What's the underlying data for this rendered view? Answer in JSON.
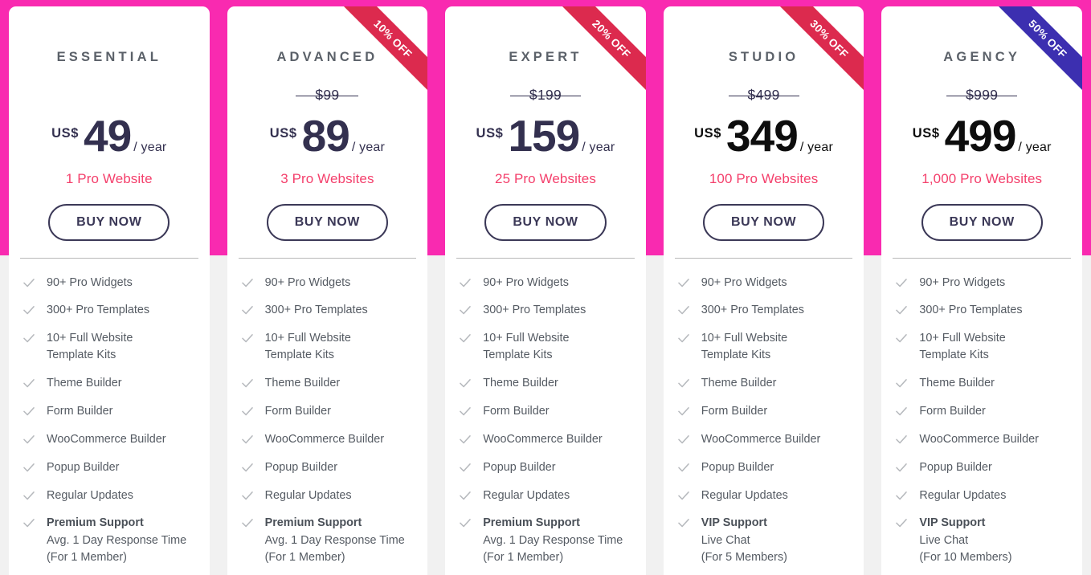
{
  "theme": {
    "band_color": "#f92ab0",
    "page_bg": "#f1f1f1",
    "card_bg": "#ffffff",
    "title_color": "#5b6169",
    "price_navy": "#33304f",
    "price_black": "#0d0d0d",
    "sites_color": "#f4406c",
    "button_border": "#3b3857",
    "check_color": "#b6b9bd",
    "feature_color": "#555b63",
    "ribbon_red": "#dc2a4e",
    "ribbon_indigo": "#3c2fb0"
  },
  "plans": [
    {
      "name": "ESSENTIAL",
      "ribbon": null,
      "ribbon_color": null,
      "original_price": "",
      "currency": "US$",
      "amount": "49",
      "period": "/ year",
      "price_theme": "navy",
      "sites": "1 Pro Website",
      "buy_label": "BUY NOW",
      "features": [
        {
          "title": "",
          "lines": [
            "90+ Pro Widgets"
          ]
        },
        {
          "title": "",
          "lines": [
            "300+ Pro Templates"
          ]
        },
        {
          "title": "",
          "lines": [
            "10+ Full Website",
            "Template Kits"
          ]
        },
        {
          "title": "",
          "lines": [
            "Theme Builder"
          ]
        },
        {
          "title": "",
          "lines": [
            "Form Builder"
          ]
        },
        {
          "title": "",
          "lines": [
            "WooCommerce Builder"
          ]
        },
        {
          "title": "",
          "lines": [
            "Popup Builder"
          ]
        },
        {
          "title": "",
          "lines": [
            "Regular Updates"
          ]
        },
        {
          "title": "Premium Support",
          "lines": [
            "Avg. 1 Day Response Time",
            "(For 1 Member)"
          ]
        }
      ]
    },
    {
      "name": "ADVANCED",
      "ribbon": "10% OFF",
      "ribbon_color": "#dc2a4e",
      "original_price": "$99",
      "currency": "US$",
      "amount": "89",
      "period": "/ year",
      "price_theme": "navy",
      "sites": "3 Pro Websites",
      "buy_label": "BUY NOW",
      "features": [
        {
          "title": "",
          "lines": [
            "90+ Pro Widgets"
          ]
        },
        {
          "title": "",
          "lines": [
            "300+ Pro Templates"
          ]
        },
        {
          "title": "",
          "lines": [
            "10+ Full Website",
            "Template Kits"
          ]
        },
        {
          "title": "",
          "lines": [
            "Theme Builder"
          ]
        },
        {
          "title": "",
          "lines": [
            "Form Builder"
          ]
        },
        {
          "title": "",
          "lines": [
            "WooCommerce Builder"
          ]
        },
        {
          "title": "",
          "lines": [
            "Popup Builder"
          ]
        },
        {
          "title": "",
          "lines": [
            "Regular Updates"
          ]
        },
        {
          "title": "Premium Support",
          "lines": [
            "Avg. 1 Day Response Time",
            "(For 1 Member)"
          ]
        }
      ]
    },
    {
      "name": "EXPERT",
      "ribbon": "20% OFF",
      "ribbon_color": "#dc2a4e",
      "original_price": "$199",
      "currency": "US$",
      "amount": "159",
      "period": "/ year",
      "price_theme": "navy",
      "sites": "25 Pro Websites",
      "buy_label": "BUY NOW",
      "features": [
        {
          "title": "",
          "lines": [
            "90+ Pro Widgets"
          ]
        },
        {
          "title": "",
          "lines": [
            "300+ Pro Templates"
          ]
        },
        {
          "title": "",
          "lines": [
            "10+ Full Website",
            "Template Kits"
          ]
        },
        {
          "title": "",
          "lines": [
            "Theme Builder"
          ]
        },
        {
          "title": "",
          "lines": [
            "Form Builder"
          ]
        },
        {
          "title": "",
          "lines": [
            "WooCommerce Builder"
          ]
        },
        {
          "title": "",
          "lines": [
            "Popup Builder"
          ]
        },
        {
          "title": "",
          "lines": [
            "Regular Updates"
          ]
        },
        {
          "title": "Premium Support",
          "lines": [
            "Avg. 1 Day Response Time",
            "(For 1 Member)"
          ]
        }
      ]
    },
    {
      "name": "STUDIO",
      "ribbon": "30% OFF",
      "ribbon_color": "#dc2a4e",
      "original_price": "$499",
      "currency": "US$",
      "amount": "349",
      "period": "/ year",
      "price_theme": "black",
      "sites": "100 Pro Websites",
      "buy_label": "BUY NOW",
      "features": [
        {
          "title": "",
          "lines": [
            "90+ Pro Widgets"
          ]
        },
        {
          "title": "",
          "lines": [
            "300+ Pro Templates"
          ]
        },
        {
          "title": "",
          "lines": [
            "10+ Full Website",
            "Template Kits"
          ]
        },
        {
          "title": "",
          "lines": [
            "Theme Builder"
          ]
        },
        {
          "title": "",
          "lines": [
            "Form Builder"
          ]
        },
        {
          "title": "",
          "lines": [
            "WooCommerce Builder"
          ]
        },
        {
          "title": "",
          "lines": [
            "Popup Builder"
          ]
        },
        {
          "title": "",
          "lines": [
            "Regular Updates"
          ]
        },
        {
          "title": "VIP Support",
          "lines": [
            "Live Chat",
            "(For 5 Members)"
          ]
        }
      ]
    },
    {
      "name": "AGENCY",
      "ribbon": "50% OFF",
      "ribbon_color": "#3c2fb0",
      "original_price": "$999",
      "currency": "US$",
      "amount": "499",
      "period": "/ year",
      "price_theme": "black",
      "sites": "1,000 Pro Websites",
      "buy_label": "BUY NOW",
      "features": [
        {
          "title": "",
          "lines": [
            "90+ Pro Widgets"
          ]
        },
        {
          "title": "",
          "lines": [
            "300+ Pro Templates"
          ]
        },
        {
          "title": "",
          "lines": [
            "10+ Full Website",
            "Template Kits"
          ]
        },
        {
          "title": "",
          "lines": [
            "Theme Builder"
          ]
        },
        {
          "title": "",
          "lines": [
            "Form Builder"
          ]
        },
        {
          "title": "",
          "lines": [
            "WooCommerce Builder"
          ]
        },
        {
          "title": "",
          "lines": [
            "Popup Builder"
          ]
        },
        {
          "title": "",
          "lines": [
            "Regular Updates"
          ]
        },
        {
          "title": "VIP Support",
          "lines": [
            "Live Chat",
            "(For 10 Members)"
          ]
        }
      ]
    }
  ]
}
